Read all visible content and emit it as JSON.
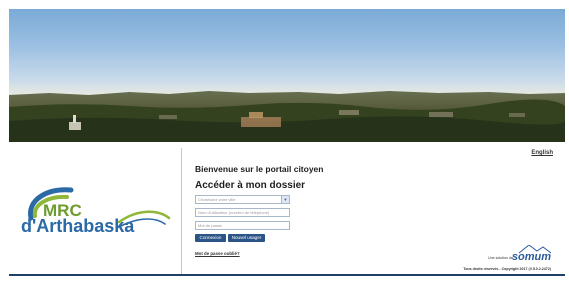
{
  "lang_link": "English",
  "welcome_title": "Bienvenue sur le portail citoyen",
  "form_heading": "Accéder à mon dossier",
  "city_select": {
    "placeholder": "Choisissez votre ville"
  },
  "username_field": {
    "placeholder": "Nom d'utilisateur (numéro de téléphone)"
  },
  "password_field": {
    "placeholder": "Mot de passe"
  },
  "buttons": {
    "login": "Connexion",
    "new_user": "Nouvel usager"
  },
  "forgot_password": "Mot de passe oublié?",
  "logo": {
    "line1": "MRC",
    "line2": "d'Arthabaska"
  },
  "vendor": {
    "prefix": "Une solution de",
    "name": "somum"
  },
  "copyright": "Tous droits réservés - Copyright 2017 (V.5.0.2.2472)",
  "colors": {
    "brand_green": "#8fb83a",
    "brand_blue": "#2b6aa6",
    "button": "#2c5587"
  }
}
